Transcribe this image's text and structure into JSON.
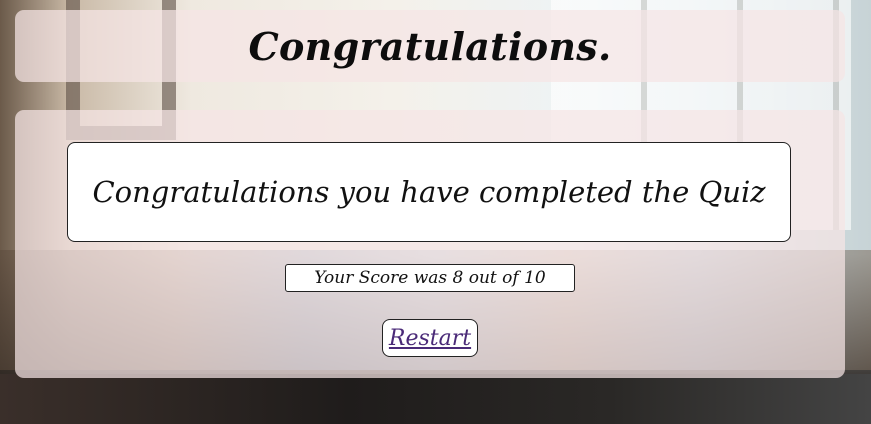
{
  "header": {
    "title": "Congratulations."
  },
  "main": {
    "message": "Congratulations you have completed the Quiz",
    "score_text": "Your Score was 8 out of 10",
    "restart_label": "Restart"
  },
  "colors": {
    "panel_background": "#f5e4e4",
    "link": "#4a2a78",
    "text": "#111111"
  }
}
